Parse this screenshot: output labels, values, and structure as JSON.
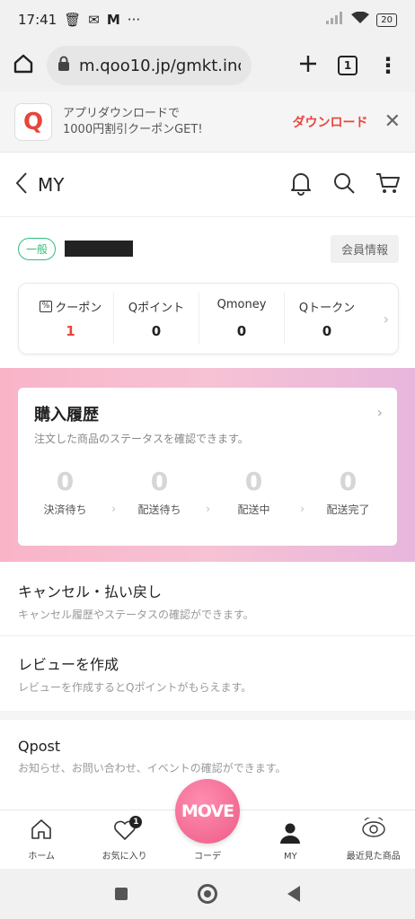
{
  "status_bar": {
    "time": "17:41",
    "battery": "20"
  },
  "browser": {
    "url": "m.qoo10.jp/gmkt.inc/",
    "tab_count": "1"
  },
  "app_banner": {
    "logo_letter": "Q",
    "text_line1": "アプリダウンロードで",
    "text_line2": "1000円割引クーポンGET!",
    "download_label": "ダウンロード"
  },
  "header": {
    "title": "MY"
  },
  "profile": {
    "rank": "一般",
    "member_info_label": "会員情報"
  },
  "points": [
    {
      "label": "クーポン",
      "value": "1"
    },
    {
      "label": "Qポイント",
      "value": "0"
    },
    {
      "label": "Qmoney",
      "value": "0"
    },
    {
      "label": "Qトークン",
      "value": "0"
    }
  ],
  "purchase_history": {
    "title": "購入履歴",
    "subtitle": "注文した商品のステータスを確認できます。",
    "steps": [
      {
        "count": "0",
        "label": "決済待ち"
      },
      {
        "count": "0",
        "label": "配送待ち"
      },
      {
        "count": "0",
        "label": "配送中"
      },
      {
        "count": "0",
        "label": "配送完了"
      }
    ]
  },
  "menu": [
    {
      "title": "キャンセル・払い戻し",
      "subtitle": "キャンセル履歴やステータスの確認ができます。"
    },
    {
      "title": "レビューを作成",
      "subtitle": "レビューを作成するとQポイントがもらえます。"
    },
    {
      "title": "Qpost",
      "subtitle": "お知らせ、お問い合わせ、イベントの確認ができます。"
    }
  ],
  "tab_bar": {
    "tabs": [
      {
        "label": "ホーム"
      },
      {
        "label": "お気に入り",
        "badge": "1"
      },
      {
        "label": "コーデ"
      },
      {
        "label": "MY"
      },
      {
        "label": "最近見た商品"
      }
    ],
    "center_button": "MOVE"
  },
  "colors": {
    "accent_red": "#e8453c",
    "rank_green": "#2fbf7a",
    "pink": "#f26b93"
  },
  "icons": [
    "home-icon",
    "lock-icon",
    "plus-icon",
    "bell-icon",
    "search-icon",
    "cart-icon",
    "heart-icon",
    "user-icon",
    "eye-icon"
  ]
}
